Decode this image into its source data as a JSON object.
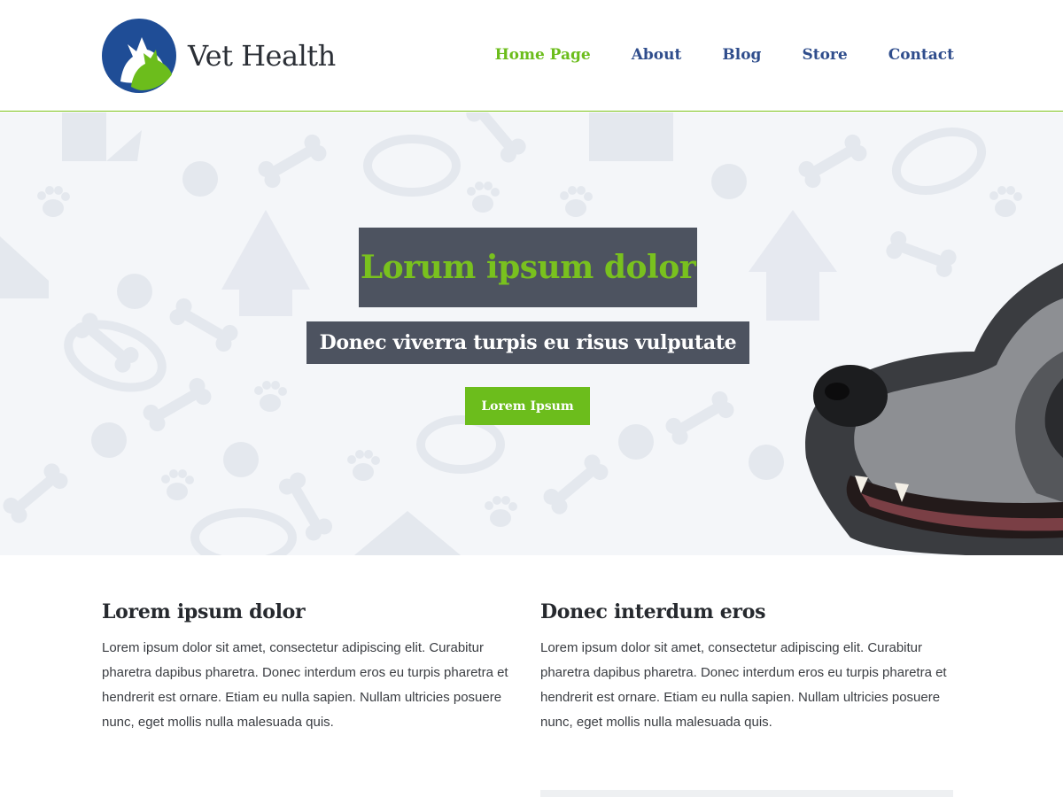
{
  "site": {
    "name": "Vet Health"
  },
  "nav": {
    "items": [
      {
        "label": "Home Page",
        "active": true
      },
      {
        "label": "About",
        "active": false
      },
      {
        "label": "Blog",
        "active": false
      },
      {
        "label": "Store",
        "active": false
      },
      {
        "label": "Contact",
        "active": false
      }
    ]
  },
  "hero": {
    "title": "Lorum ipsum dolor",
    "subtitle": "Donec viverra turpis eu risus vulputate",
    "button_label": "Lorem Ipsum"
  },
  "columns": [
    {
      "heading": "Lorem ipsum dolor",
      "body": "Lorem ipsum dolor sit amet, consectetur adipiscing elit. Curabitur pharetra dapibus pharetra. Donec interdum eros eu turpis pharetra et hendrerit est ornare. Etiam eu nulla sapien. Nullam ultricies posuere nunc, eget mollis nulla malesuada quis."
    },
    {
      "heading": "Donec interdum eros",
      "body": "Lorem ipsum dolor sit amet, consectetur adipiscing elit. Curabitur pharetra dapibus pharetra. Donec interdum eros eu turpis pharetra et hendrerit est ornare. Etiam eu nulla sapien. Nullam ultricies posuere nunc, eget mollis nulla malesuada quis."
    }
  ],
  "colors": {
    "brand_blue": "#1f4d96",
    "brand_green": "#6cbd1c",
    "nav_blue": "#2f4d8c",
    "hero_box": "#4d5360"
  },
  "icons": {
    "logo": "dog-cat-logo-icon",
    "pattern": [
      "bone-icon",
      "paw-icon",
      "ball-icon",
      "bowl-icon",
      "house-icon"
    ]
  }
}
